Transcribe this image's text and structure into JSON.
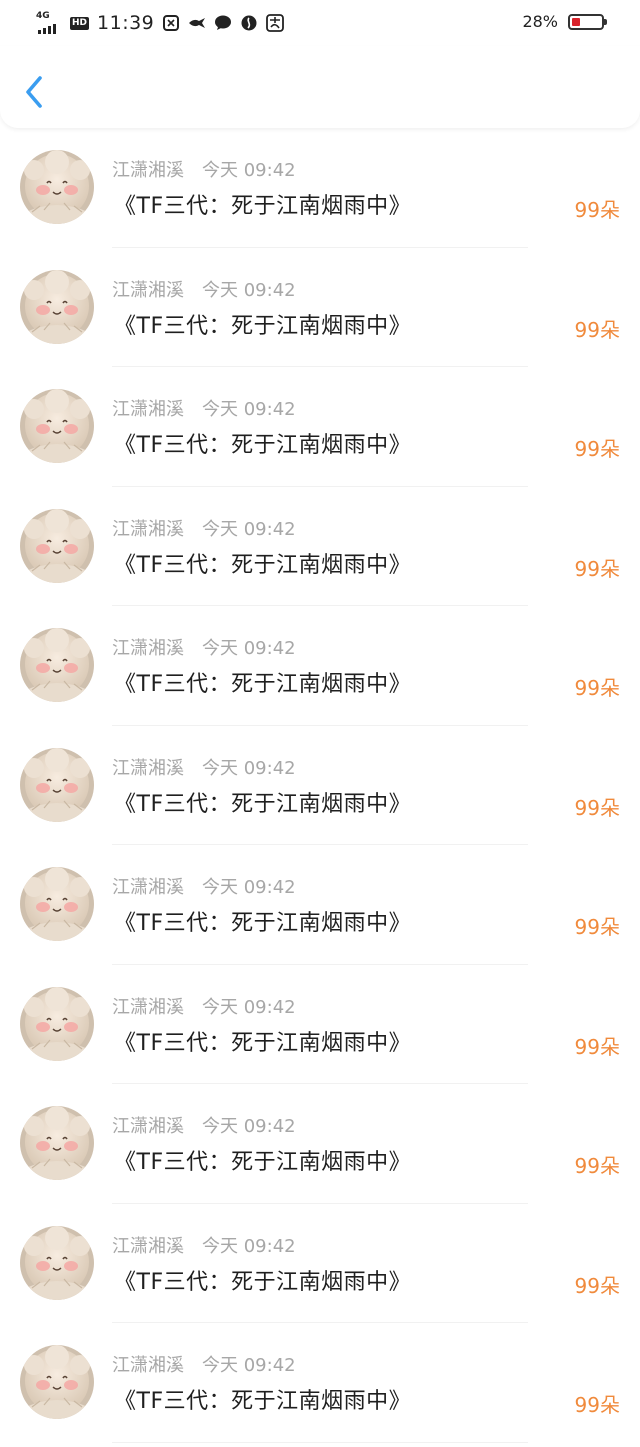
{
  "status_bar": {
    "network": "4G",
    "hd": "HD",
    "time": "11:39",
    "battery_percent": "28%",
    "battery_level": 0.28,
    "icons": [
      "app-icon",
      "bird-icon",
      "chat-bubble-icon",
      "browser-icon",
      "alipay-icon"
    ]
  },
  "nav": {
    "back_icon": "chevron-left-icon",
    "accent_color": "#3a9df0"
  },
  "colors": {
    "meta_text": "#a7a7a7",
    "amount_text": "#f08a3c",
    "title_text": "#1f1f1f"
  },
  "list": [
    {
      "user": "江潇湘溪",
      "time": "今天 09:42",
      "title": "《TF三代：死于江南烟雨中》",
      "amount": "99朵"
    },
    {
      "user": "江潇湘溪",
      "time": "今天 09:42",
      "title": "《TF三代：死于江南烟雨中》",
      "amount": "99朵"
    },
    {
      "user": "江潇湘溪",
      "time": "今天 09:42",
      "title": "《TF三代：死于江南烟雨中》",
      "amount": "99朵"
    },
    {
      "user": "江潇湘溪",
      "time": "今天 09:42",
      "title": "《TF三代：死于江南烟雨中》",
      "amount": "99朵"
    },
    {
      "user": "江潇湘溪",
      "time": "今天 09:42",
      "title": "《TF三代：死于江南烟雨中》",
      "amount": "99朵"
    },
    {
      "user": "江潇湘溪",
      "time": "今天 09:42",
      "title": "《TF三代：死于江南烟雨中》",
      "amount": "99朵"
    },
    {
      "user": "江潇湘溪",
      "time": "今天 09:42",
      "title": "《TF三代：死于江南烟雨中》",
      "amount": "99朵"
    },
    {
      "user": "江潇湘溪",
      "time": "今天 09:42",
      "title": "《TF三代：死于江南烟雨中》",
      "amount": "99朵"
    },
    {
      "user": "江潇湘溪",
      "time": "今天 09:42",
      "title": "《TF三代：死于江南烟雨中》",
      "amount": "99朵"
    },
    {
      "user": "江潇湘溪",
      "time": "今天 09:42",
      "title": "《TF三代：死于江南烟雨中》",
      "amount": "99朵"
    },
    {
      "user": "江潇湘溪",
      "time": "今天 09:42",
      "title": "《TF三代：死于江南烟雨中》",
      "amount": "99朵"
    }
  ]
}
